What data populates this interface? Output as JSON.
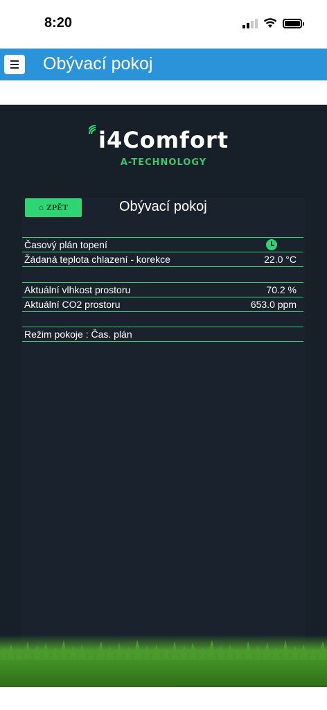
{
  "status_bar": {
    "time": "8:20"
  },
  "header": {
    "title": "Obývací pokoj"
  },
  "logo": {
    "main": "i4Comfort",
    "sub": "A-TECHNOLOGY"
  },
  "panel": {
    "back_label": "ZPĚT",
    "title": "Obývací pokoj",
    "rows": [
      {
        "label": "Časový plán topení",
        "value": ""
      },
      {
        "label": "Žádaná teplota chlazení - korekce",
        "value": "22.0 °C"
      },
      {
        "label": "Aktuální vlhkost prostoru",
        "value": "70.2 %"
      },
      {
        "label": "Aktuální CO2 prostoru",
        "value": "653.0 ppm"
      },
      {
        "label": "Režim pokoje :  Čas. plán",
        "value": ""
      }
    ]
  },
  "colors": {
    "header": "#2b93d9",
    "accent": "#2ed573",
    "background": "#172029"
  }
}
